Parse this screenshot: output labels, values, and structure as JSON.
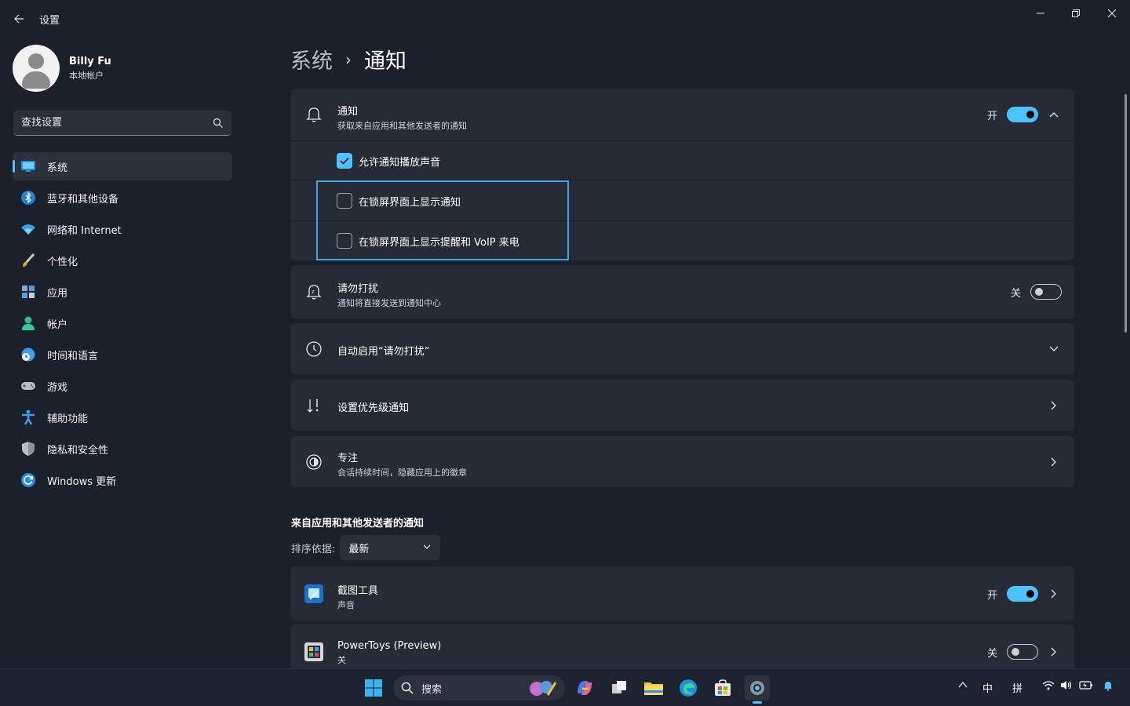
{
  "window": {
    "title": "设置"
  },
  "profile": {
    "name": "Billy Fu",
    "account": "本地帐户"
  },
  "search": {
    "placeholder": "查找设置"
  },
  "nav": {
    "items": [
      {
        "label": "系统",
        "icon": "system-icon"
      },
      {
        "label": "蓝牙和其他设备",
        "icon": "bluetooth-icon"
      },
      {
        "label": "网络和 Internet",
        "icon": "wifi-icon"
      },
      {
        "label": "个性化",
        "icon": "brush-icon"
      },
      {
        "label": "应用",
        "icon": "apps-icon"
      },
      {
        "label": "帐户",
        "icon": "account-icon"
      },
      {
        "label": "时间和语言",
        "icon": "clock-globe-icon"
      },
      {
        "label": "游戏",
        "icon": "gamepad-icon"
      },
      {
        "label": "辅助功能",
        "icon": "accessibility-icon"
      },
      {
        "label": "隐私和安全性",
        "icon": "shield-icon"
      },
      {
        "label": "Windows 更新",
        "icon": "update-icon"
      }
    ],
    "active": "系统"
  },
  "breadcrumb": {
    "parent": "系统",
    "sep": "›",
    "current": "通知"
  },
  "notifications": {
    "title": "通知",
    "subtitle": "获取来自应用和其他发送者的通知",
    "state": "开",
    "toggle_on": true,
    "options": [
      {
        "label": "允许通知播放声音",
        "checked": true
      },
      {
        "label": "在锁屏界面上显示通知",
        "checked": false
      },
      {
        "label": "在锁屏界面上显示提醒和 VoIP 来电",
        "checked": false
      }
    ]
  },
  "dnd": {
    "title": "请勿打扰",
    "subtitle": "通知将直接发送到通知中心",
    "state": "关",
    "toggle_on": false
  },
  "auto_dnd": {
    "title": "自动启用“请勿打扰”"
  },
  "priority": {
    "title": "设置优先级通知"
  },
  "focus": {
    "title": "专注",
    "subtitle": "会话持续时间，隐藏应用上的徽章"
  },
  "senders": {
    "section_title": "来自应用和其他发送者的通知",
    "sort_label": "排序依据:",
    "sort_value": "最新",
    "apps": [
      {
        "name": "截图工具",
        "detail": "声音",
        "state": "开",
        "toggle_on": true
      },
      {
        "name": "PowerToys (Preview)",
        "detail": "关",
        "state": "关",
        "toggle_on": false
      }
    ]
  },
  "taskbar": {
    "search_placeholder": "搜索",
    "ime_lang": "中",
    "ime_mode": "拼"
  },
  "colors": {
    "accent": "#4cc2ff",
    "background": "#1c202b",
    "card": "#262b36",
    "highlight": "#3ba7df"
  }
}
